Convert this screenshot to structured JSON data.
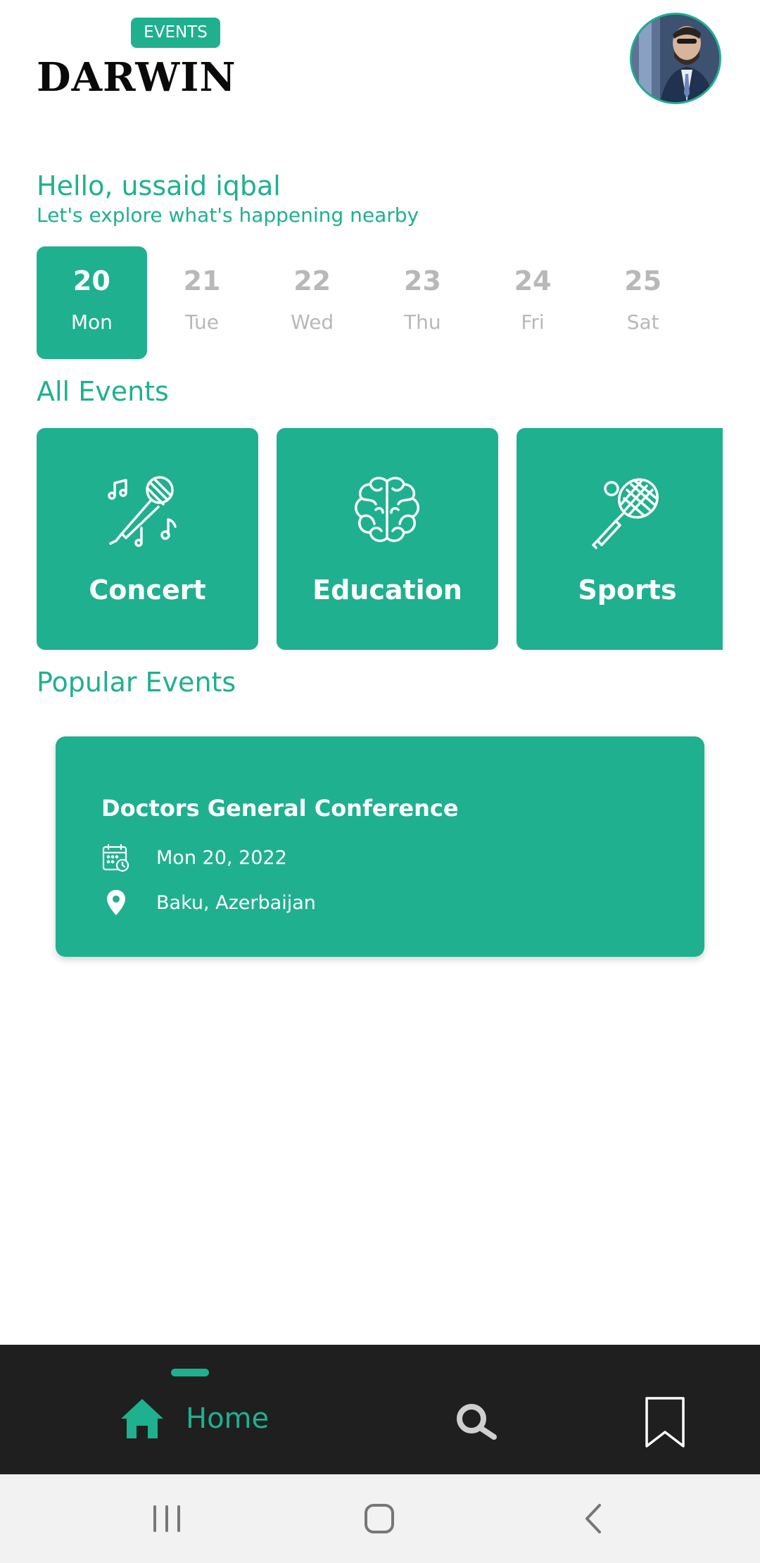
{
  "header": {
    "badge": "EVENTS",
    "logo": "DARWIN",
    "avatar_icon": "user-avatar"
  },
  "greeting": {
    "title": "Hello, ussaid iqbal",
    "subtitle": "Let's explore what's happening nearby"
  },
  "dates": [
    {
      "num": "20",
      "day": "Mon",
      "selected": true
    },
    {
      "num": "21",
      "day": "Tue",
      "selected": false
    },
    {
      "num": "22",
      "day": "Wed",
      "selected": false
    },
    {
      "num": "23",
      "day": "Thu",
      "selected": false
    },
    {
      "num": "24",
      "day": "Fri",
      "selected": false
    },
    {
      "num": "25",
      "day": "Sat",
      "selected": false
    }
  ],
  "sections": {
    "all_events": "All Events",
    "popular_events": "Popular Events"
  },
  "categories": [
    {
      "label": "Concert",
      "icon": "microphone-music-icon"
    },
    {
      "label": "Education",
      "icon": "brain-icon"
    },
    {
      "label": "Sports",
      "icon": "tennis-racket-icon"
    }
  ],
  "popular_event": {
    "title": "Doctors General Conference",
    "date": "Mon 20, 2022",
    "location": "Baku, Azerbaijan",
    "date_icon": "calendar-clock-icon",
    "location_icon": "location-pin-icon"
  },
  "bottom_nav": {
    "home_label": "Home",
    "home_icon": "home-icon",
    "search_icon": "search-icon",
    "bookmark_icon": "bookmark-icon"
  },
  "colors": {
    "accent": "#1fb08f",
    "nav_background": "#1f1f1f",
    "inactive_text": "#b8b8b8"
  }
}
